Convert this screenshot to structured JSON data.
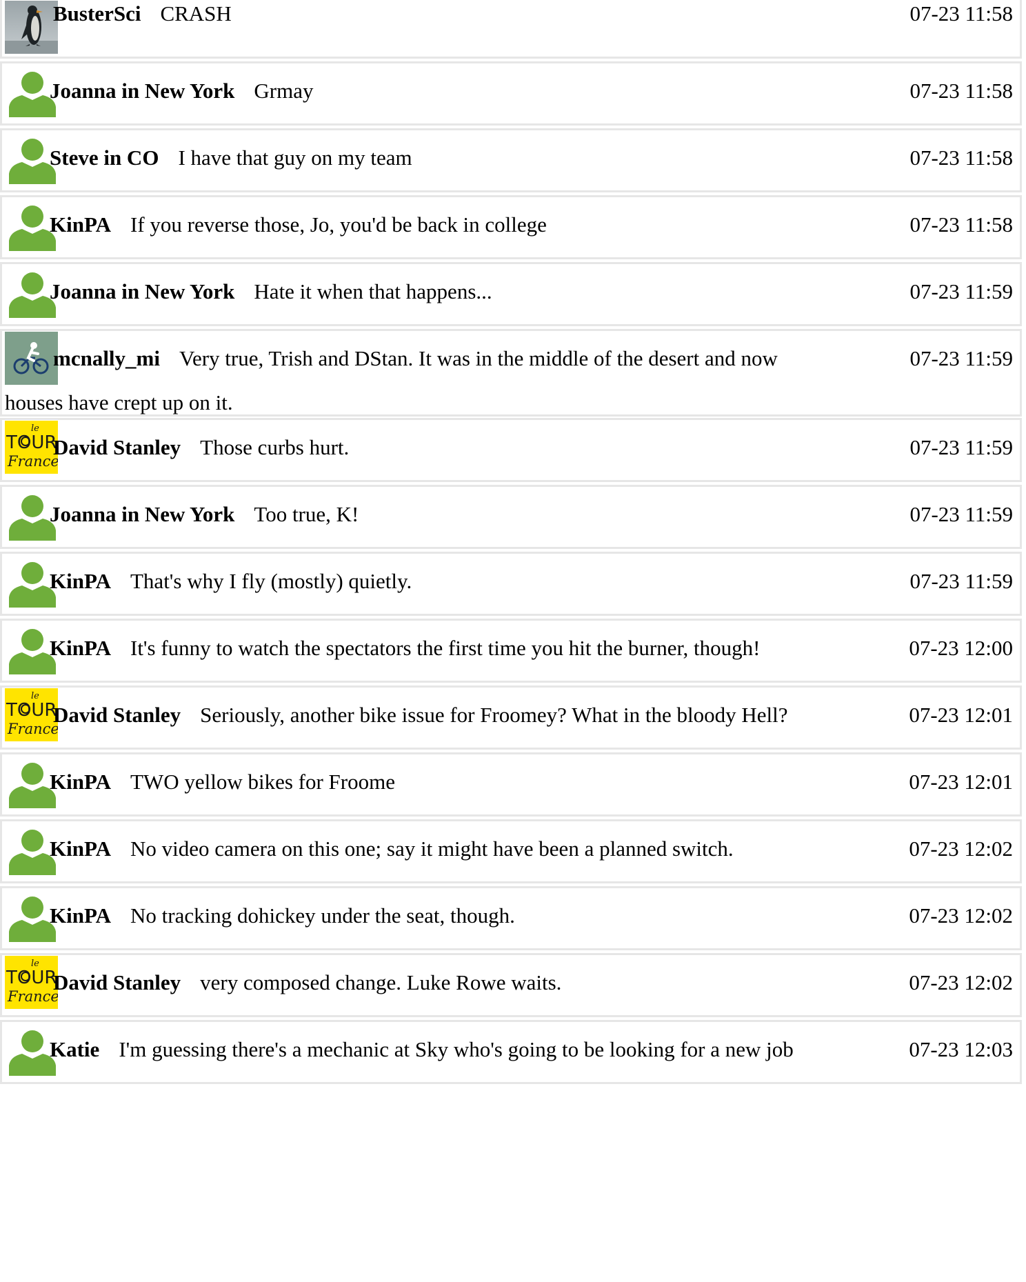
{
  "messages": [
    {
      "user": "BusterSci",
      "text": "CRASH",
      "time": "07-23 11:58",
      "avatar": "penguin-photo-avatar"
    },
    {
      "user": "Joanna in New York",
      "text": "Grmay",
      "time": "07-23 11:58",
      "avatar": "default-user-icon"
    },
    {
      "user": "Steve in CO",
      "text": "I have that guy on my team",
      "time": "07-23 11:58",
      "avatar": "default-user-icon"
    },
    {
      "user": "KinPA",
      "text": "If you reverse those, Jo, you'd be back in college",
      "time": "07-23 11:58",
      "avatar": "default-user-icon"
    },
    {
      "user": "Joanna in New York",
      "text": "Hate it when that happens...",
      "time": "07-23 11:59",
      "avatar": "default-user-icon"
    },
    {
      "user": "mcnally_mi",
      "text": "Very true, Trish and DStan. It was in the middle of the desert and now",
      "text_cont": "houses have crept up on it.",
      "time": "07-23 11:59",
      "avatar": "cyclist-avatar"
    },
    {
      "user": "David Stanley",
      "text": "Those curbs hurt.",
      "time": "07-23 11:59",
      "avatar": "tour-de-france-logo-avatar"
    },
    {
      "user": "Joanna in New York",
      "text": "Too true, K!",
      "time": "07-23 11:59",
      "avatar": "default-user-icon"
    },
    {
      "user": "KinPA",
      "text": "That's why I fly (mostly) quietly.",
      "time": "07-23 11:59",
      "avatar": "default-user-icon"
    },
    {
      "user": "KinPA",
      "text": "It's funny to watch the spectators the first time you hit the burner, though!",
      "time": "07-23 12:00",
      "avatar": "default-user-icon"
    },
    {
      "user": "David Stanley",
      "text": "Seriously, another bike issue for Froomey? What in the bloody Hell?",
      "time": "07-23 12:01",
      "avatar": "tour-de-france-logo-avatar"
    },
    {
      "user": "KinPA",
      "text": "TWO yellow bikes for Froome",
      "time": "07-23 12:01",
      "avatar": "default-user-icon"
    },
    {
      "user": "KinPA",
      "text": "No video camera on this one; say it might have been a planned switch.",
      "time": "07-23 12:02",
      "avatar": "default-user-icon"
    },
    {
      "user": "KinPA",
      "text": "No tracking dohickey under the seat, though.",
      "time": "07-23 12:02",
      "avatar": "default-user-icon"
    },
    {
      "user": "David Stanley",
      "text": "very composed change. Luke Rowe waits.",
      "time": "07-23 12:02",
      "avatar": "tour-de-france-logo-avatar"
    },
    {
      "user": "Katie",
      "text": "I'm guessing there's a mechanic at Sky who's going to be looking for a new job",
      "time": "07-23 12:03",
      "avatar": "default-user-icon"
    }
  ],
  "colors": {
    "avatar_green": "#6fae3b",
    "border": "#e6e6e6",
    "tdf_yellow": "#ffe400"
  }
}
